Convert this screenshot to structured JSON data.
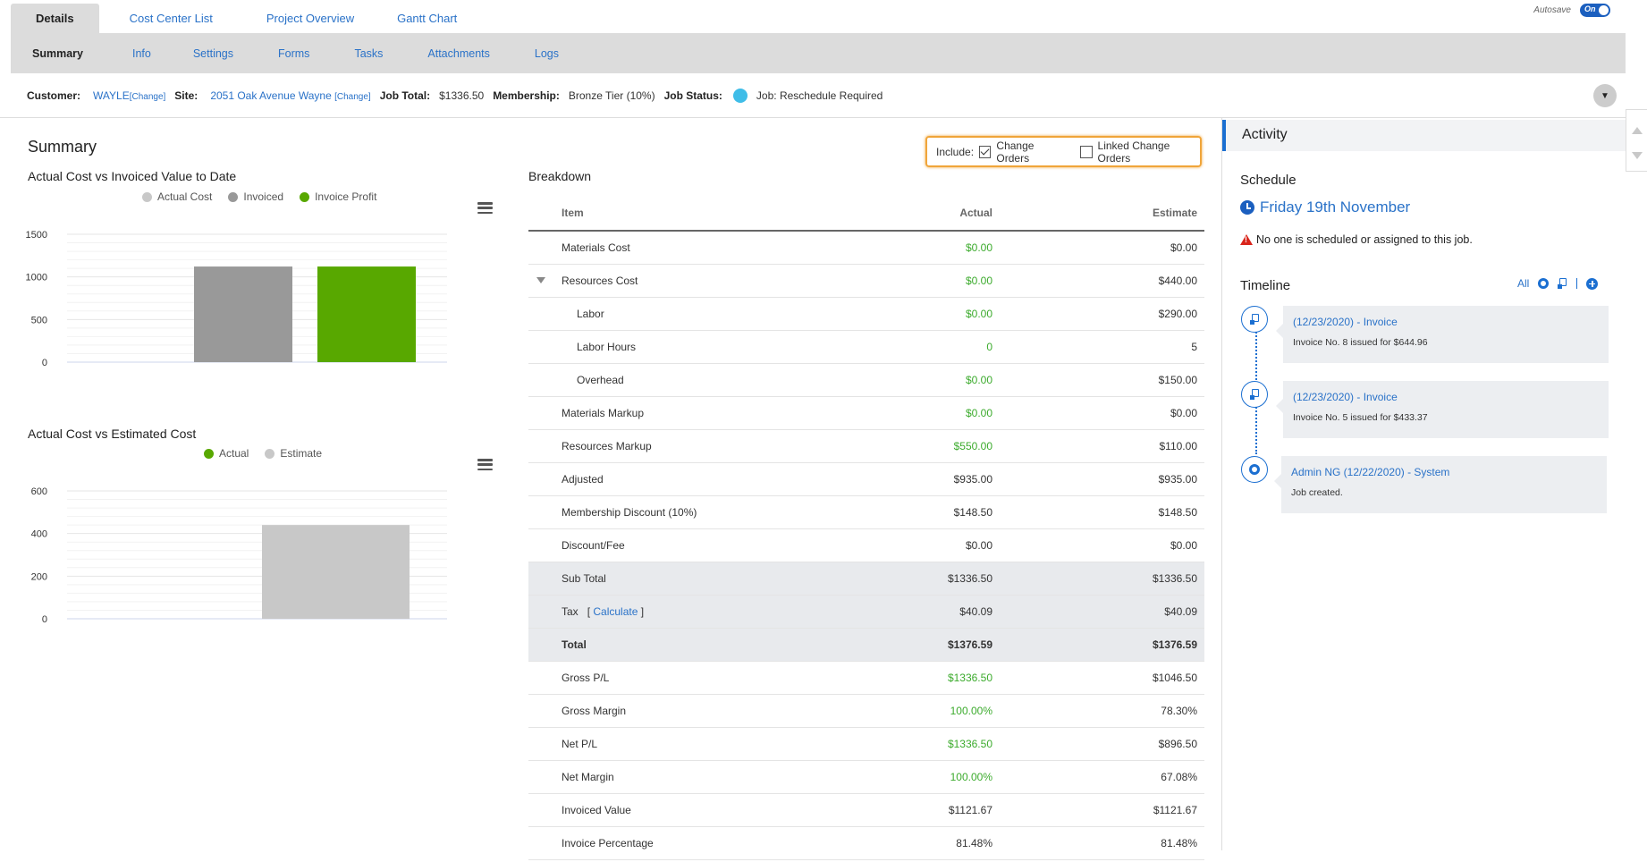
{
  "top_tabs": [
    {
      "label": "Details",
      "active": true
    },
    {
      "label": "Cost Center List",
      "active": false
    },
    {
      "label": "Project Overview",
      "active": false
    },
    {
      "label": "Gantt Chart",
      "active": false
    }
  ],
  "autosave": {
    "label": "Autosave",
    "state": "On"
  },
  "sub_tabs": [
    {
      "label": "Summary",
      "active": true
    },
    {
      "label": "Info"
    },
    {
      "label": "Settings"
    },
    {
      "label": "Forms"
    },
    {
      "label": "Tasks"
    },
    {
      "label": "Attachments"
    },
    {
      "label": "Logs"
    }
  ],
  "info": {
    "customer_label": "Customer:",
    "customer_value": "WAYLE",
    "change_label": "[Change]",
    "site_label": "Site:",
    "site_value": "2051 Oak Avenue Wayne",
    "job_total_label": "Job Total:",
    "job_total_value": "$1336.50",
    "membership_label": "Membership:",
    "membership_value": "Bronze Tier (10%)",
    "job_status_label": "Job Status:",
    "job_status_value": "Job: Reschedule Required",
    "status_color": "#3fbde8"
  },
  "summary": {
    "title": "Summary"
  },
  "chart_data": [
    {
      "type": "bar",
      "title": "Actual Cost vs Invoiced Value to Date",
      "series": [
        {
          "name": "Actual Cost",
          "color": "#c8c8c8",
          "value": 0
        },
        {
          "name": "Invoiced",
          "color": "#999999",
          "value": 1121.67
        },
        {
          "name": "Invoice Profit",
          "color": "#58a800",
          "value": 1121.67
        }
      ],
      "yticks": [
        "1500",
        "1000",
        "500",
        "0"
      ],
      "ylim": [
        0,
        1500
      ]
    },
    {
      "type": "bar",
      "title": "Actual Cost vs Estimated Cost",
      "series": [
        {
          "name": "Actual",
          "color": "#58a800",
          "value": 0
        },
        {
          "name": "Estimate",
          "color": "#c8c8c8",
          "value": 440
        }
      ],
      "yticks": [
        "600",
        "400",
        "200",
        "0"
      ],
      "ylim": [
        0,
        600
      ]
    }
  ],
  "include": {
    "label": "Include:",
    "change_orders": "Change Orders",
    "change_orders_checked": true,
    "linked_change_orders": "Linked Change Orders",
    "linked_checked": false
  },
  "breakdown": {
    "title": "Breakdown",
    "headers": {
      "item": "Item",
      "actual": "Actual",
      "estimate": "Estimate"
    },
    "rows": [
      {
        "item": "Materials Cost",
        "actual": "$0.00",
        "estimate": "$0.00"
      },
      {
        "item": "Resources Cost",
        "actual": "$0.00",
        "estimate": "$440.00"
      },
      {
        "item": "Labor",
        "actual": "$0.00",
        "estimate": "$290.00"
      },
      {
        "item": "Labor Hours",
        "actual": "0",
        "estimate": "5"
      },
      {
        "item": "Overhead",
        "actual": "$0.00",
        "estimate": "$150.00"
      },
      {
        "item": "Materials Markup",
        "actual": "$0.00",
        "estimate": "$0.00"
      },
      {
        "item": "Resources Markup",
        "actual": "$550.00",
        "estimate": "$110.00"
      },
      {
        "item": "Adjusted",
        "actual": "$935.00",
        "estimate": "$935.00"
      },
      {
        "item": "Membership Discount (10%)",
        "actual": "$148.50",
        "estimate": "$148.50"
      },
      {
        "item": "Discount/Fee",
        "actual": "$0.00",
        "estimate": "$0.00"
      },
      {
        "item": "Sub Total",
        "actual": "$1336.50",
        "estimate": "$1336.50"
      },
      {
        "item": "Tax",
        "calc_label": "Calculate",
        "actual": "$40.09",
        "estimate": "$40.09"
      },
      {
        "item": "Total",
        "actual": "$1376.59",
        "estimate": "$1376.59"
      },
      {
        "item": "Gross P/L",
        "actual": "$1336.50",
        "estimate": "$1046.50"
      },
      {
        "item": "Gross Margin",
        "actual": "100.00%",
        "estimate": "78.30%"
      },
      {
        "item": "Net P/L",
        "actual": "$1336.50",
        "estimate": "$896.50"
      },
      {
        "item": "Net Margin",
        "actual": "100.00%",
        "estimate": "67.08%"
      },
      {
        "item": "Invoiced Value",
        "actual": "$1121.67",
        "estimate": "$1121.67"
      },
      {
        "item": "Invoice Percentage",
        "actual": "81.48%",
        "estimate": "81.48%"
      }
    ]
  },
  "activity": {
    "title": "Activity",
    "schedule_title": "Schedule",
    "schedule_date": "Friday 19th November",
    "warning": "No one is scheduled or assigned to this job.",
    "timeline_title": "Timeline",
    "filter_all": "All",
    "events": [
      {
        "title": "(12/23/2020) - Invoice",
        "desc": "Invoice No. 8 issued for $644.96"
      },
      {
        "title": "(12/23/2020) - Invoice",
        "desc": "Invoice No. 5 issued for $433.37"
      },
      {
        "title": "Admin NG (12/22/2020) - System",
        "desc": "Job created."
      }
    ]
  }
}
